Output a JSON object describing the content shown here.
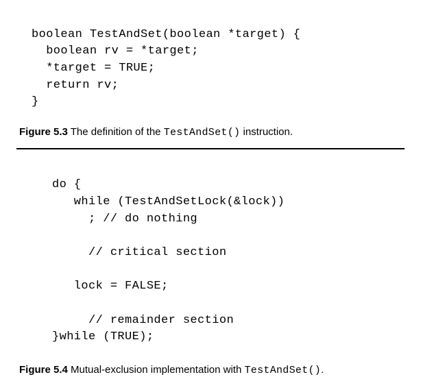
{
  "fig53": {
    "code_line1": "boolean TestAndSet(boolean *target) {",
    "code_line2": "  boolean rv = *target;",
    "code_line3": "  *target = TRUE;",
    "code_line4": "  return rv;",
    "code_line5": "}",
    "caption_label": "Figure 5.3",
    "caption_text_before": "  The definition of the ",
    "caption_code": "TestAndSet()",
    "caption_text_after": " instruction."
  },
  "fig54": {
    "code_line1": "do {",
    "code_line2": "   while (TestAndSetLock(&lock))",
    "code_line3": "     ; // do nothing",
    "code_line4": "",
    "code_line5": "     // critical section",
    "code_line6": "",
    "code_line7": "   lock = FALSE;",
    "code_line8": "",
    "code_line9": "     // remainder section",
    "code_line10": "}while (TRUE);",
    "caption_label": "Figure 5.4",
    "caption_text_before": "  Mutual-exclusion implementation with ",
    "caption_code": "TestAndSet()",
    "caption_text_after": "."
  }
}
